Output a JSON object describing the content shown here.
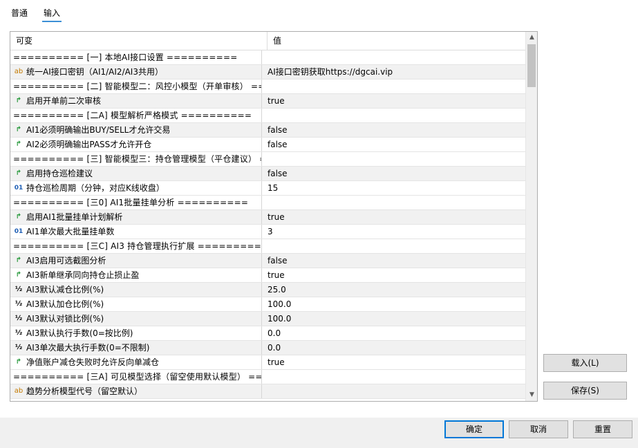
{
  "tabs": [
    {
      "label": "普通",
      "active": false
    },
    {
      "label": "输入",
      "active": true
    }
  ],
  "grid": {
    "col_variable": "可变",
    "col_value": "值"
  },
  "rows": [
    {
      "kind": "sep",
      "name": "========== [一] 本地AI接口设置 ==========",
      "value": ""
    },
    {
      "kind": "string",
      "name": "统一AI接口密钥（AI1/AI2/AI3共用）",
      "value": "AI接口密钥获取https://dgcai.vip"
    },
    {
      "kind": "sep",
      "name": "========== [二] 智能模型二：风控小模型（开单审核） ===...",
      "value": ""
    },
    {
      "kind": "bool",
      "name": "启用开单前二次审核",
      "value": "true"
    },
    {
      "kind": "sep",
      "name": "========== [二A] 模型解析严格模式 ==========",
      "value": ""
    },
    {
      "kind": "bool",
      "name": "AI1必须明确输出BUY/SELL才允许交易",
      "value": "false"
    },
    {
      "kind": "bool",
      "name": "AI2必须明确输出PASS才允许开仓",
      "value": "false"
    },
    {
      "kind": "sep",
      "name": "========== [三] 智能模型三：持仓管理模型（平仓建议） =...",
      "value": ""
    },
    {
      "kind": "bool",
      "name": "启用持仓巡检建议",
      "value": "false"
    },
    {
      "kind": "int",
      "name": "持仓巡检周期（分钟，对应K线收盘）",
      "value": "15"
    },
    {
      "kind": "sep",
      "name": "========== [三0] AI1批量挂单分析 ==========",
      "value": ""
    },
    {
      "kind": "bool",
      "name": "启用AI1批量挂单计划解析",
      "value": "true"
    },
    {
      "kind": "int",
      "name": "AI1单次最大批量挂单数",
      "value": "3"
    },
    {
      "kind": "sep",
      "name": "========== [三C] AI3 持仓管理执行扩展 ==========",
      "value": ""
    },
    {
      "kind": "bool",
      "name": "AI3启用可选截图分析",
      "value": "false"
    },
    {
      "kind": "bool",
      "name": "AI3新单继承同向持仓止损止盈",
      "value": "true"
    },
    {
      "kind": "double",
      "name": "AI3默认减仓比例(%)",
      "value": "25.0"
    },
    {
      "kind": "double",
      "name": "AI3默认加仓比例(%)",
      "value": "100.0"
    },
    {
      "kind": "double",
      "name": "AI3默认对锁比例(%)",
      "value": "100.0"
    },
    {
      "kind": "double",
      "name": "AI3默认执行手数(0=按比例)",
      "value": "0.0"
    },
    {
      "kind": "double",
      "name": "AI3单次最大执行手数(0=不限制)",
      "value": "0.0"
    },
    {
      "kind": "bool",
      "name": "净值账户减仓失败时允许反向单减仓",
      "value": "true"
    },
    {
      "kind": "sep",
      "name": "========== [三A] 可见模型选择（留空使用默认模型） ===...",
      "value": ""
    },
    {
      "kind": "string",
      "name": "趋势分析模型代号（留空默认）",
      "value": ""
    }
  ],
  "icons": {
    "string": {
      "name": "text-type-icon",
      "glyph": "ab"
    },
    "bool": {
      "name": "bool-type-icon",
      "glyph": "↱"
    },
    "int": {
      "name": "int-type-icon",
      "glyph": "01"
    },
    "double": {
      "name": "double-type-icon",
      "glyph": "½"
    }
  },
  "side_buttons": {
    "load": "载入(L)",
    "save": "保存(S)"
  },
  "footer": {
    "ok": "确定",
    "cancel": "取消",
    "reset": "重置"
  },
  "colors": {
    "accent": "#0078d7",
    "bool_icon": "#2a9a3e",
    "string_icon": "#c47a00",
    "number_icon": "#1f5fb5"
  }
}
